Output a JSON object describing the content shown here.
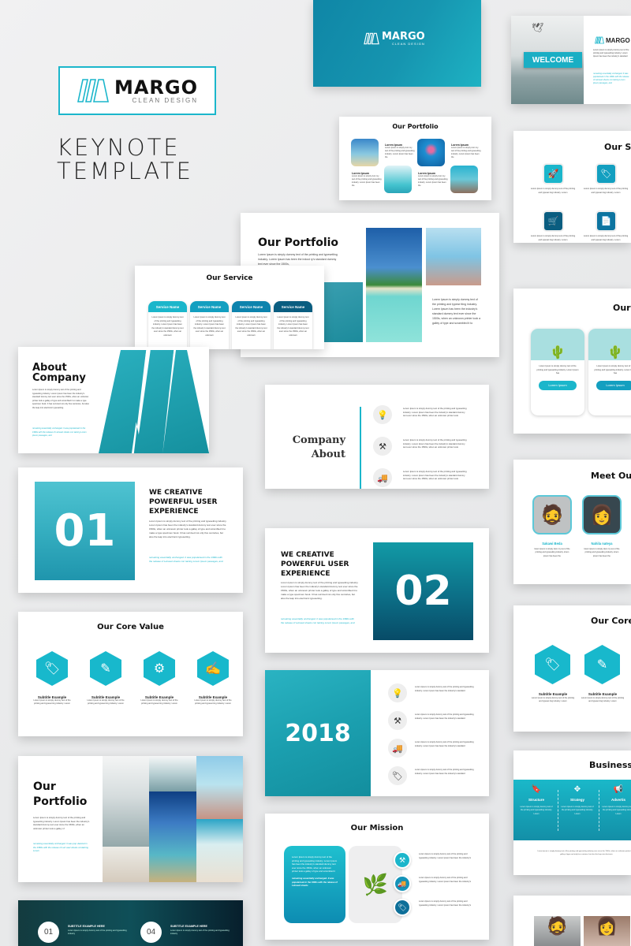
{
  "brand": {
    "name": "MARGO",
    "tagline": "CLEAN DESIGN",
    "accent": "#1bb6cb"
  },
  "hero": {
    "line1": "KEYNOTE",
    "line2": "TEMPLATE"
  },
  "lorem_short": "Lorem Ipsum is simply dummy text of the printing and typesetting industry. Lorem Ipsum has been the industry's standard",
  "lorem_long": "Lorem Ipsum is simply dummy text of the printing and typesetting industry. Lorem Ipsum has been the industry's standard dummy text ever since the 1500s, when an unknown printer took a galley of type and scrambled it to make a type specimen book. It has survived not only five centuries, but also the leap into electronic typesetting.",
  "italic_note": "remaining essentially unchanged. It was popularised in the 1960s with the release of Letraset sheets con taining Lorem Ipsum passages, and",
  "slides": {
    "cover": {
      "brand": "MARGO",
      "tagline": "CLEAN DESIGN"
    },
    "welcome": {
      "label": "WELCOME",
      "brand": "MARGO",
      "tagline": "CLEAN DESIGN"
    },
    "portfolio_grid": {
      "title": "Our Portfolio",
      "item_title": "Lorem Ipsum",
      "item_text": "Lorem Ipsum is simply dum my text of the printing and typesetting industry. Lorem Ipsum has been the"
    },
    "portfolio_big": {
      "title": "Our Portfolio",
      "text": "Lorem Ipsum is simply dummy text of the printing and typesetting industry. Lorem Ipsum has been the indust ry's standard dummy text ever since the 1500s,",
      "side_text": "Lorem Ipsum is simply dummy text of the printing and typese tting industry. Lorem Ipsum has been the industry's standard dummy text ever since the 1500s, when an unknown printer took a galley of type and scrambled it to"
    },
    "service": {
      "title": "Our Service",
      "cards": [
        {
          "label": "Service Name",
          "color": "#1bb6cb"
        },
        {
          "label": "Service Name",
          "color": "#139fc0"
        },
        {
          "label": "Service Name",
          "color": "#0d83ad"
        },
        {
          "label": "Service Name",
          "color": "#0a5d80"
        }
      ],
      "card_text": "Lorem Ipsum is simply dummy text of the printing and typesetting industry. Lorem Ipsum has been the industry's standard dummy text ever since the 1500s, when an unknown"
    },
    "about": {
      "title_line1": "About",
      "title_line2": "Company"
    },
    "company_about": {
      "title_line1": "Company",
      "title_line2": "About",
      "items": [
        {
          "icon": "lightbulb-icon",
          "glyph": "💡"
        },
        {
          "icon": "tools-icon",
          "glyph": "⚒"
        },
        {
          "icon": "truck-icon",
          "glyph": "🚚"
        }
      ],
      "item_text": "Lorem Ipsum is simply dummy text of the printing and typesetting industry. Lorem Ipsum has been the industry's standard dummy text ever since the 1500s, when an unknown printer took"
    },
    "creative1": {
      "number": "01",
      "title": "WE CREATIVE POWERFUL USER EXPERIENCE"
    },
    "creative2": {
      "number": "02",
      "title": "WE CREATIVE POWERFUL USER EXPERIENCE"
    },
    "core_value": {
      "title": "Our Core Value",
      "items": [
        {
          "subtitle": "Subtitle Example",
          "icon": "tag-icon",
          "glyph": "🏷"
        },
        {
          "subtitle": "Subtitle Example",
          "icon": "pencil-ruler-icon",
          "glyph": "✎"
        },
        {
          "subtitle": "Subtitle Example",
          "icon": "mobile-gear-icon",
          "glyph": "⚙"
        },
        {
          "subtitle": "Subtitle Example",
          "icon": "edit-document-icon",
          "glyph": "✍"
        }
      ],
      "item_text": "Lorem Ipsum is simply dummy text of the printing and typeset ting industry. Lorem"
    },
    "year": {
      "number": "2018",
      "items": [
        {
          "icon": "lightbulb-icon",
          "glyph": "💡"
        },
        {
          "icon": "tools-icon",
          "glyph": "⚒"
        },
        {
          "icon": "truck-icon",
          "glyph": "🚚"
        },
        {
          "icon": "tag-icon",
          "glyph": "🏷"
        }
      ],
      "item_text": "Lorem Ipsum is simply dummy text of the printing and typesetting industry. Lorem Ipsum has been the industry's standard"
    },
    "portfolio_collage": {
      "title_line1": "Our",
      "title_line2": "Portfolio",
      "text": "Lorem Ipsum is simply dummy text of the printing and typesetting industry. Lorem Ipsum has been the industry's standard dummy text ever since the 1500s, when an unknown printer took a galley of",
      "italic": "remaining essentially unchanged. It was pop ularized in the 1960s with the release of Letr aset sheets containing Lorem"
    },
    "mission": {
      "title": "Our Mission",
      "box_text": "Lorem Ipsum is simply dummy text of the printing and typesetting industry. Lorem Ipsum has been the industry's standard dummy text ever since the 1500s, when an unknown printer took a galley of type and scrambled it",
      "box_italic": "remaining essentially unchanged. It was popularised in the 1960s with the release of Letraset sheets",
      "items": [
        {
          "icon": "tools-icon",
          "glyph": "⚒"
        },
        {
          "icon": "truck-icon",
          "glyph": "🚚"
        },
        {
          "icon": "tag-icon",
          "glyph": "🏷"
        }
      ],
      "item_text": "Lorem Ipsum is simply dummy text of the printing and typesetting industry. Lorem Ipsum has been the industry's"
    },
    "subtitles": {
      "items": [
        {
          "number": "01",
          "title": "SUBTITLE EXAMPLE HERE"
        },
        {
          "number": "04",
          "title": "SUBTITLE EXAMPLE HERE"
        }
      ],
      "text": "Lorem Ipsum is simply dummy text of the printing and typesetting industry"
    },
    "our_s": {
      "title": "Our S",
      "icons": [
        {
          "icon": "rocket-icon",
          "glyph": "🚀",
          "color": "#1bb6cb"
        },
        {
          "icon": "tag-icon",
          "glyph": "🏷",
          "color": "#139fc0"
        },
        {
          "icon": "cart-icon",
          "glyph": "🛒",
          "color": "#0a5d80"
        },
        {
          "icon": "document-icon",
          "glyph": "📄",
          "color": "#0d74a0"
        }
      ],
      "text": "Lorem Ipsum is simply dummy text of the printing and typeset ting industry. Lorem"
    },
    "our_cards": {
      "title": "Our",
      "button_label": "Lorem Ipsum",
      "text": "Lorem Ipsum is simply dummy text of the printing and typesetting industry. Lorem Ipsum has"
    },
    "team": {
      "title": "Meet Ou",
      "members": [
        {
          "name": "Sakawi Beda"
        },
        {
          "name": "Nahila nateya"
        }
      ],
      "text": "lorem ipsum is simply dum my text of the printing and typesetting industry. lorem ipsum has been the"
    },
    "core_value_2": {
      "title": "Our Core",
      "items": [
        {
          "subtitle": "Subtitle Example",
          "glyph": "🏷"
        },
        {
          "subtitle": "Subtitle Example",
          "glyph": "✎"
        }
      ],
      "text": "Lorem Ipsum is simply dummy text of the printing and typeset ting industry. Lorem"
    },
    "business": {
      "title": "Business",
      "items": [
        {
          "label": "Structure",
          "glyph": "🔖"
        },
        {
          "label": "Strategy",
          "glyph": "✥"
        },
        {
          "label": "Advertis",
          "glyph": "📢"
        }
      ],
      "item_text": "Lorem Ipsum is simply dummy text of the printing and typesetting industry. Lorem",
      "footer_text": "Lorem Ipsum is simply dummy text of the printing and typesetting industry ever since the 1500s, when an unknown printer took a galley of type and only five centuries, but also the leap into electronic"
    }
  }
}
